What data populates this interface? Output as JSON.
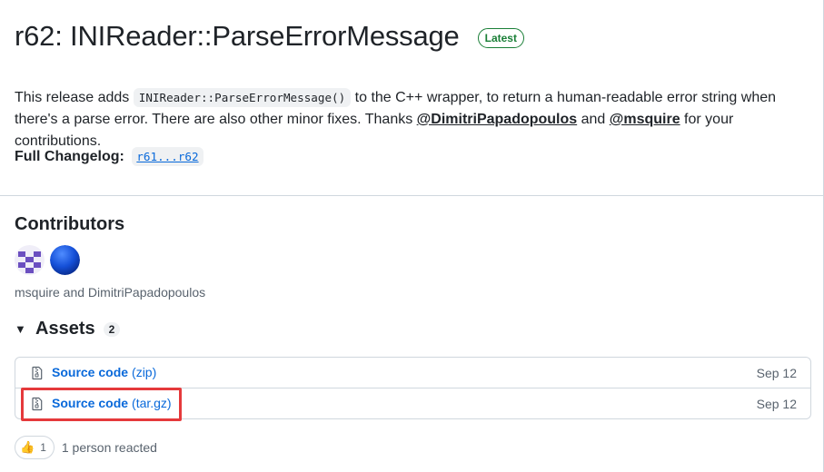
{
  "release": {
    "title": "r62: INIReader::ParseErrorMessage",
    "badge": "Latest"
  },
  "description": {
    "part1": "This release adds ",
    "code": "INIReader::ParseErrorMessage()",
    "part2": " to the C++ wrapper, to return a human-readable error string when there's a parse error. There are also other minor fixes. Thanks ",
    "mention1": "@DimitriPapadopoulos",
    "part3": " and ",
    "mention2": "@msquire",
    "part4": " for your contributions."
  },
  "changelog": {
    "label": "Full Changelog:",
    "link": "r61...r62"
  },
  "contributors": {
    "title": "Contributors",
    "names": "msquire and DimitriPapadopoulos"
  },
  "assets": {
    "title": "Assets",
    "count": "2",
    "items": [
      {
        "name": "Source code",
        "ext": "(zip)",
        "date": "Sep 12"
      },
      {
        "name": "Source code",
        "ext": "(tar.gz)",
        "date": "Sep 12"
      }
    ]
  },
  "reactions": {
    "emoji": "👍",
    "count": "1",
    "text": "1 person reacted"
  },
  "colors": {
    "link": "#0969da",
    "latest_green": "#1a7f37",
    "highlight": "#e5393b"
  }
}
